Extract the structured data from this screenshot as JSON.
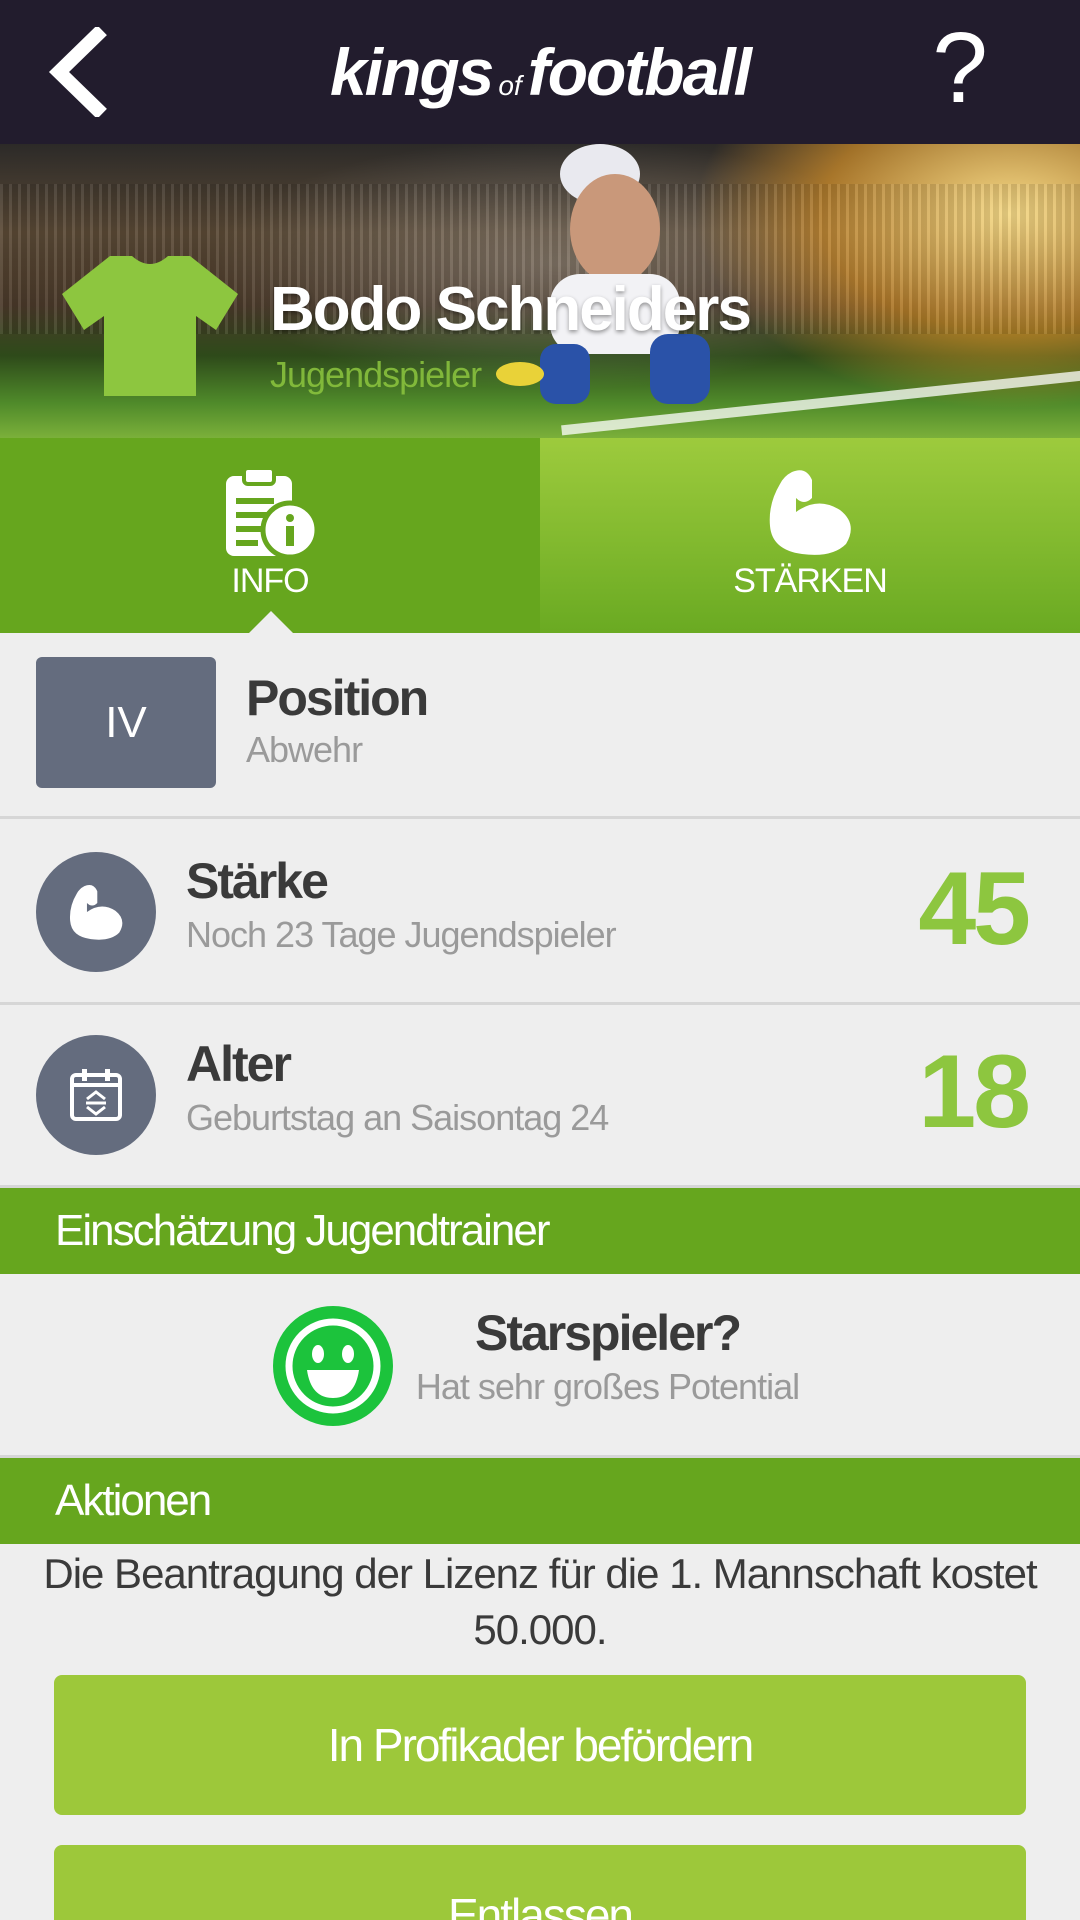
{
  "header": {
    "brand_part1": "kings",
    "brand_part2": "of",
    "brand_part3": "football",
    "back_icon": "chevron-left-icon",
    "help_label": "?"
  },
  "hero": {
    "player_name": "Bodo Schneiders",
    "player_status": "Jugendspieler",
    "shirt_icon": "shirt-icon",
    "shirt_color": "#8dc63f"
  },
  "tabs": [
    {
      "label": "INFO",
      "icon": "clipboard-info-icon",
      "active": true
    },
    {
      "label": "STÄRKEN",
      "icon": "flexed-arm-icon",
      "active": false
    }
  ],
  "position": {
    "badge": "IV",
    "title": "Position",
    "subtitle": "Abwehr"
  },
  "strength": {
    "title": "Stärke",
    "subtitle": "Noch 23 Tage Jugendspieler",
    "value": "45",
    "icon": "flexed-arm-icon"
  },
  "age": {
    "title": "Alter",
    "subtitle": "Geburtstag an Saisontag 24",
    "value": "18",
    "icon": "calendar-icon"
  },
  "coach_section": {
    "header": "Einschätzung Jugendtrainer",
    "title": "Starspieler?",
    "subtitle": "Hat sehr großes Potential",
    "icon": "smiley-icon",
    "icon_color": "#1cc33c"
  },
  "actions_section": {
    "header": "Aktionen",
    "text": "Die Beantragung der Lizenz für die 1. Mannschaft kostet 50.000.",
    "promote_label": "In Profikader befördern",
    "dismiss_label": "Entlassen"
  },
  "colors": {
    "topbar": "#221c2d",
    "green_dark": "#66a61e",
    "green_light": "#9dc83a",
    "value_green": "#8dc63f",
    "badge_gray": "#646c7e"
  }
}
